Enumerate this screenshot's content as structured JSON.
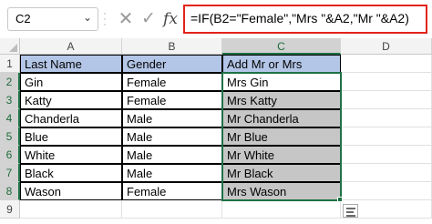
{
  "formula_bar": {
    "name_box": "C2",
    "cancel_glyph": "✕",
    "enter_glyph": "✓",
    "fx_label": "fx",
    "formula": "=IF(B2=\"Female\",\"Mrs \"&A2,\"Mr \"&A2)"
  },
  "columns": [
    "A",
    "B",
    "C",
    "D"
  ],
  "rows": [
    "1",
    "2",
    "3",
    "4",
    "5",
    "6",
    "7",
    "8",
    "9"
  ],
  "table": {
    "headers": [
      "Last Name",
      "Gender",
      "Add Mr or Mrs"
    ],
    "data": [
      [
        "Gin",
        "Female",
        "Mrs Gin"
      ],
      [
        "Katty",
        "Female",
        "Mrs Katty"
      ],
      [
        "Chanderla",
        "Male",
        "Mr Chanderla"
      ],
      [
        "Blue",
        "Male",
        "Mr Blue"
      ],
      [
        "White",
        "Male",
        "Mr White"
      ],
      [
        "Black",
        "Male",
        "Mr Black"
      ],
      [
        "Wason",
        "Female",
        "Mrs Wason"
      ]
    ]
  },
  "selection": {
    "range": "C2:C8",
    "active_cell": "C2"
  },
  "colors": {
    "header_fill": "#b4c6e7",
    "selection_fill": "#c6c6c6",
    "selection_border": "#1e7145",
    "formula_highlight": "#e2231a"
  }
}
